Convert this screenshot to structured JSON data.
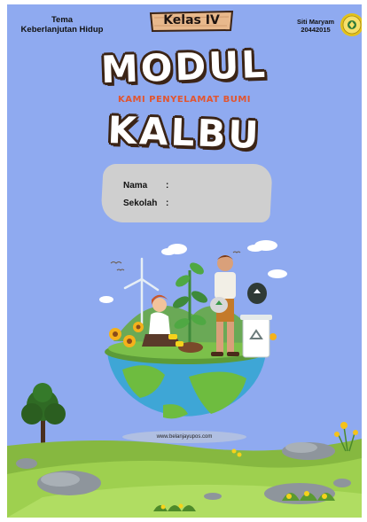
{
  "header": {
    "tema_line1": "Tema",
    "tema_line2": "Keberlanjutan Hidup",
    "kelas": "Kelas IV",
    "author_name": "Siti Maryam",
    "author_id": "20442015"
  },
  "title": {
    "top": "MODUL",
    "subtitle": "KAMI PENYELAMAT BUMI",
    "bottom": "KALBU"
  },
  "identity": {
    "nama_label": "Nama",
    "sekolah_label": "Sekolah",
    "colon": ":"
  },
  "illustration": {
    "watermark": "www.belanjayupos.com"
  },
  "colors": {
    "background": "#8faaf0",
    "title_outline": "#3b2416",
    "subtitle": "#e2552f",
    "id_box": "#cfcfcf",
    "grass": "#8fc24a",
    "ocean": "#3ea6d6"
  }
}
